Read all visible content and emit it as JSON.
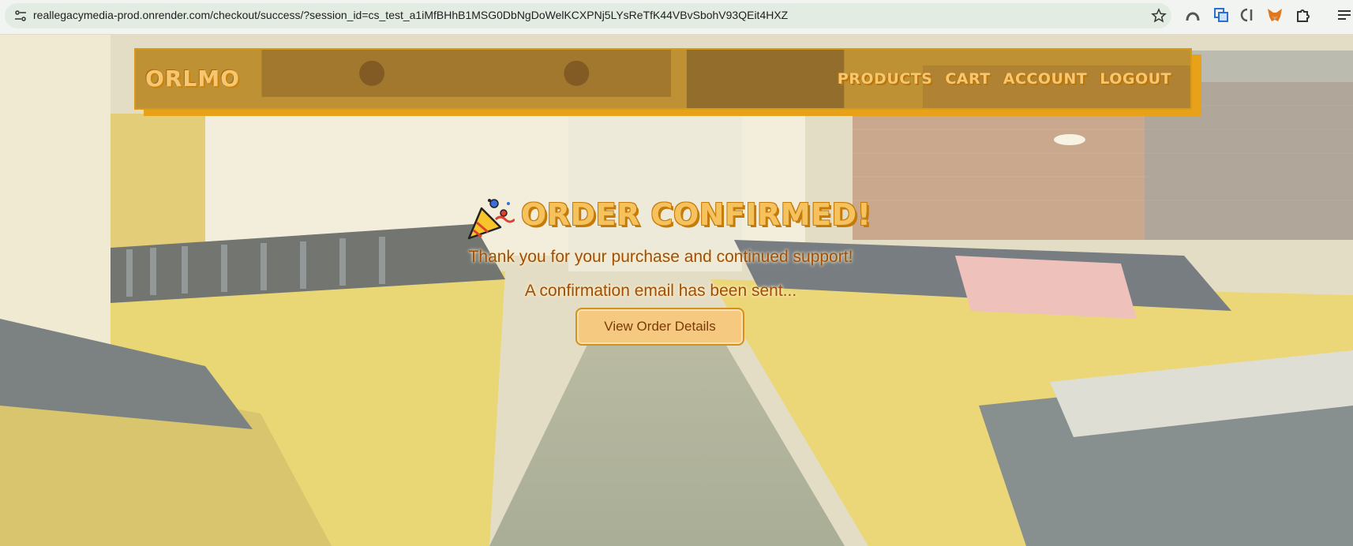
{
  "browser": {
    "url": "reallegacymedia-prod.onrender.com/checkout/success/?session_id=cs_test_a1iMfBHhB1MSG0DbNgDoWelKCXPNj5LYsReTfK44VBvSbohV93QEit4HXZ"
  },
  "header": {
    "logo": "ORLMO",
    "nav": [
      "PRODUCTS",
      "CART",
      "ACCOUNT",
      "LOGOUT"
    ]
  },
  "main": {
    "title": "ORDER CONFIRMED!",
    "thanks": "Thank you for your purchase and continued support!",
    "email_note": "A confirmation email has been sent...",
    "button_label": "View Order Details"
  },
  "colors": {
    "accent": "#e8a219",
    "title": "#f5c25e",
    "text": "#a04e08"
  }
}
